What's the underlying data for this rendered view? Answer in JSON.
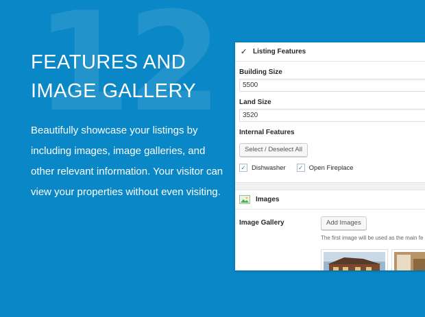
{
  "hero": {
    "number": "12",
    "title": "FEATURES AND\nIMAGE GALLERY",
    "description": "Beautifully showcase your listings by including images, image galleries, and other relevant information. Your visitor can view your properties without even visiting."
  },
  "listing_features": {
    "heading": "Listing Features",
    "building_size_label": "Building Size",
    "building_size_value": "5500",
    "land_size_label": "Land Size",
    "land_size_value": "3520",
    "internal_features_label": "Internal Features",
    "select_button": "Select / Deselect All",
    "options": [
      {
        "label": "Dishwasher",
        "checked": true
      },
      {
        "label": "Open Fireplace",
        "checked": true
      }
    ]
  },
  "images": {
    "heading": "Images",
    "gallery_label": "Image Gallery",
    "add_button": "Add Images",
    "hint": "The first image will be used as the main fe"
  },
  "colors": {
    "background": "#0a87c6",
    "accent": "#1e8cbe"
  }
}
